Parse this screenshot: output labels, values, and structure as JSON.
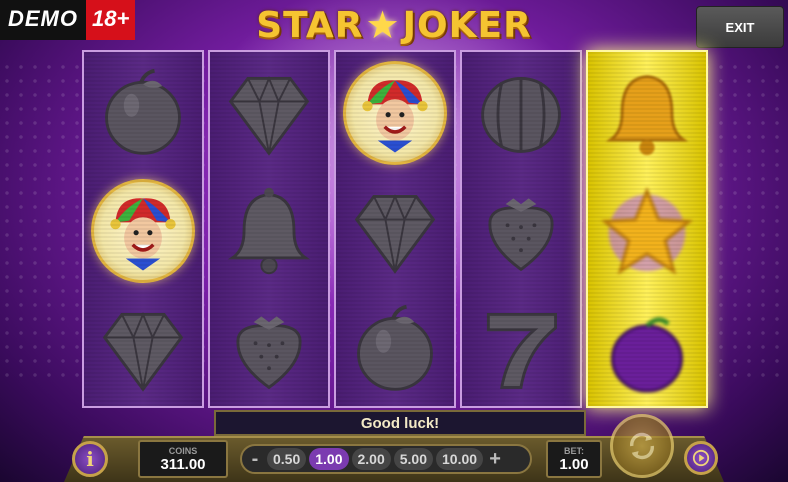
{
  "badge": {
    "demo": "DEMO",
    "age": "18+"
  },
  "logo": {
    "left": "STAR",
    "right": "JOKER"
  },
  "exit_label": "EXIT",
  "reels": [
    [
      "plum-icon",
      "joker-icon",
      "diamond-icon"
    ],
    [
      "diamond-icon",
      "bell-icon",
      "strawberry-icon"
    ],
    [
      "joker-icon",
      "diamond-icon",
      "plum-icon"
    ],
    [
      "watermelon-icon",
      "strawberry-icon",
      "seven-icon"
    ],
    [
      "bell-icon",
      "star-icon",
      "plum-icon"
    ]
  ],
  "message": "Good luck!",
  "coins": {
    "label": "COINS",
    "value": "311.00"
  },
  "bet_options": [
    "0.50",
    "1.00",
    "2.00",
    "5.00",
    "10.00"
  ],
  "bet_selected": "1.00",
  "bet": {
    "label": "BET:",
    "value": "1.00"
  },
  "controls": {
    "minus": "-",
    "plus": "+",
    "info": "i"
  },
  "colors": {
    "accent": "#7b3bb0",
    "gold": "#f5c431",
    "spinning_reel": "#fff15a"
  }
}
